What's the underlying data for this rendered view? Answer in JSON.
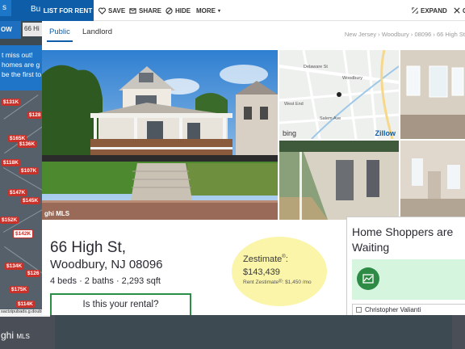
{
  "background": {
    "logo_text": "s",
    "nav_label": "Bu",
    "search_value": "66 Hi",
    "strip_label": "OW",
    "promo_lines": [
      "t miss out!",
      "homes are g",
      "be the first to"
    ],
    "footer_url": "sactzipubads.g.doubleclick.net...",
    "mls_logo": "ghi",
    "mls_suffix": "MLS",
    "pins": [
      "$131K",
      "$128",
      "$165K",
      "$136K",
      "$118K",
      "$107K",
      "$147K",
      "$145K",
      "$152K",
      "$142K",
      "$134K",
      "$126",
      "$175K",
      "$114K"
    ]
  },
  "toolbar": {
    "list_for_rent": "LIST FOR RENT",
    "save": "SAVE",
    "share": "SHARE",
    "hide": "HIDE",
    "more": "MORE",
    "expand": "EXPAND",
    "close": "C"
  },
  "tabs": {
    "public": "Public",
    "landlord": "Landlord"
  },
  "breadcrumb": "New Jersey › Woodbury › 08096 › 66 High St",
  "map": {
    "street_1": "Delaware St",
    "street_2": "Woodbury",
    "street_3": "West End",
    "street_4": "Salem Ave",
    "bing": "bing",
    "zillow": "Zillow"
  },
  "photo_badge": "ghi MLS",
  "listing": {
    "address_line1": "66 High St,",
    "address_line2": "Woodbury, NJ 08096",
    "facts": "4 beds · 2 baths · 2,293 sqft",
    "rental_question": "Is this your rental?"
  },
  "zestimate": {
    "label": "Zestimate",
    "value": "$143,439",
    "rent_label": "Rent Zestimate",
    "rent_value": ": $1,450 /mo"
  },
  "shoppers": {
    "title": "Home Shoppers are Waiting",
    "agent": "Christopher Valianti"
  },
  "colors": {
    "brand_blue": "#0d5da8",
    "pin_red": "#c8322b",
    "zestimate_yellow": "#fbf5a9",
    "green": "#2e8b45"
  }
}
